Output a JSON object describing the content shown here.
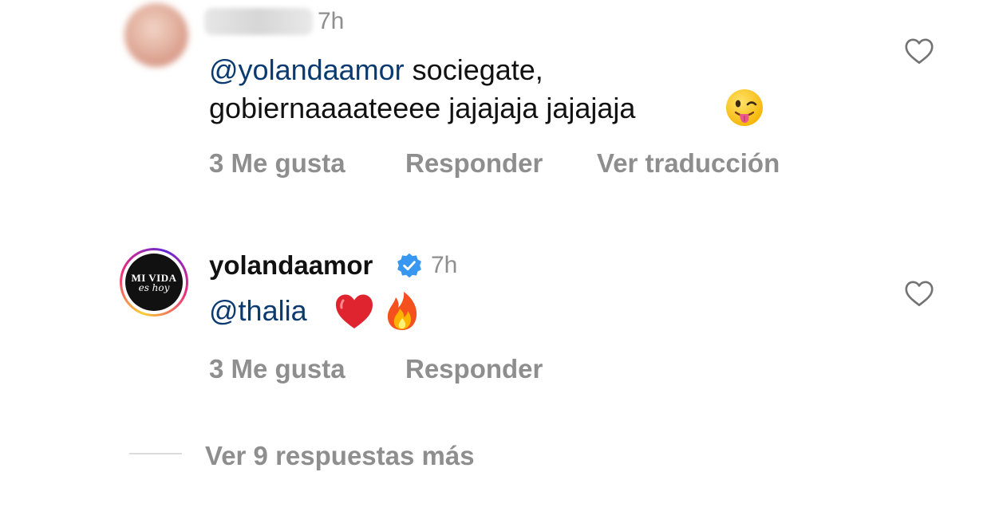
{
  "comment1": {
    "timestamp": "7h",
    "mention": "@yolandaamor",
    "text_line1_rest": " sociegate,",
    "text_line2": "gobiernaaaateeee jajajaja jajajaja",
    "emoji": "winking-face-with-tongue",
    "likes": "3 Me gusta",
    "reply": "Responder",
    "translate": "Ver traducción"
  },
  "comment2": {
    "username": "yolandaamor",
    "verified": true,
    "timestamp": "7h",
    "avatar_logo_top": "MI VIDA",
    "avatar_logo_bottom": "es hoy",
    "mention": "@thalia",
    "emojis": [
      "red-heart",
      "fire"
    ],
    "likes": "3 Me gusta",
    "reply": "Responder"
  },
  "more_replies": "Ver 9 respuestas más",
  "colors": {
    "mention": "#0b3a71",
    "secondary_text": "#8e8e8e",
    "verified_blue": "#3897f0",
    "divider": "#dbdbdb"
  }
}
